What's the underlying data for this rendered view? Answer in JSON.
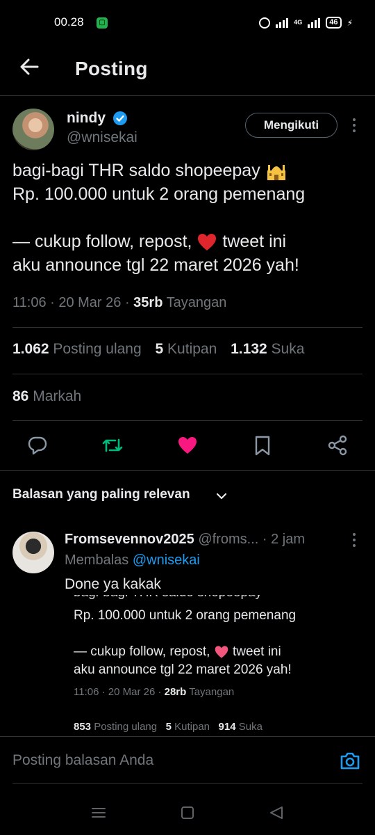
{
  "status_bar": {
    "time": "00.28",
    "network": "4G",
    "battery": "46"
  },
  "header": {
    "title": "Posting"
  },
  "post": {
    "author_name": "nindy",
    "author_handle": "@wnisekai",
    "follow_label": "Mengikuti",
    "text_line1": "bagi-bagi THR saldo shopeepay",
    "text_line2": "Rp. 100.000 untuk 2 orang pemenang",
    "text_line3_a": "— cukup follow, repost,",
    "text_line3_b": "tweet ini",
    "text_line4": "aku announce tgl 22 maret 2026 yah!",
    "timestamp": "11:06 · 20 Mar 26 · ",
    "views_count": "35rb",
    "views_label": "Tayangan",
    "reposts_count": "1.062",
    "reposts_label": "Posting ulang",
    "quotes_count": "5",
    "quotes_label": "Kutipan",
    "likes_count": "1.132",
    "likes_label": "Suka",
    "bookmarks_count": "86",
    "bookmarks_label": "Markah"
  },
  "colors": {
    "accent": "#1d9bf0",
    "repost": "#00ba7c",
    "like": "#f91880"
  },
  "replies_header": {
    "label": "Balasan yang paling relevan"
  },
  "reply": {
    "name": "Fromsevennov2025",
    "handle": "@froms...",
    "time": " · 2 jam",
    "replying_prefix": "Membalas",
    "replying_to": "@wnisekai",
    "text": "Done ya kakak"
  },
  "reply_image": {
    "line1": "Rp. 100.000 untuk 2 orang pemenang",
    "line2_a": "— cukup follow, repost,",
    "line2_b": "tweet ini",
    "line3": "aku announce tgl 22 maret 2026 yah!",
    "timestamp": "11:06 · 20 Mar 26 · ",
    "views_count": "28rb",
    "views_label": "Tayangan",
    "reposts_count": "853",
    "reposts_label": "Posting ulang",
    "quotes_count": "5",
    "quotes_label": "Kutipan",
    "likes_count": "914",
    "likes_label": "Suka"
  },
  "composer": {
    "placeholder": "Posting balasan Anda"
  },
  "icons": {
    "back": "arrow-left-icon",
    "verified": "verified-badge-icon",
    "reply": "speech-bubble-icon",
    "repost": "repost-icon",
    "like": "heart-icon",
    "bookmark": "bookmark-icon",
    "share": "share-icon",
    "camera": "camera-icon"
  }
}
